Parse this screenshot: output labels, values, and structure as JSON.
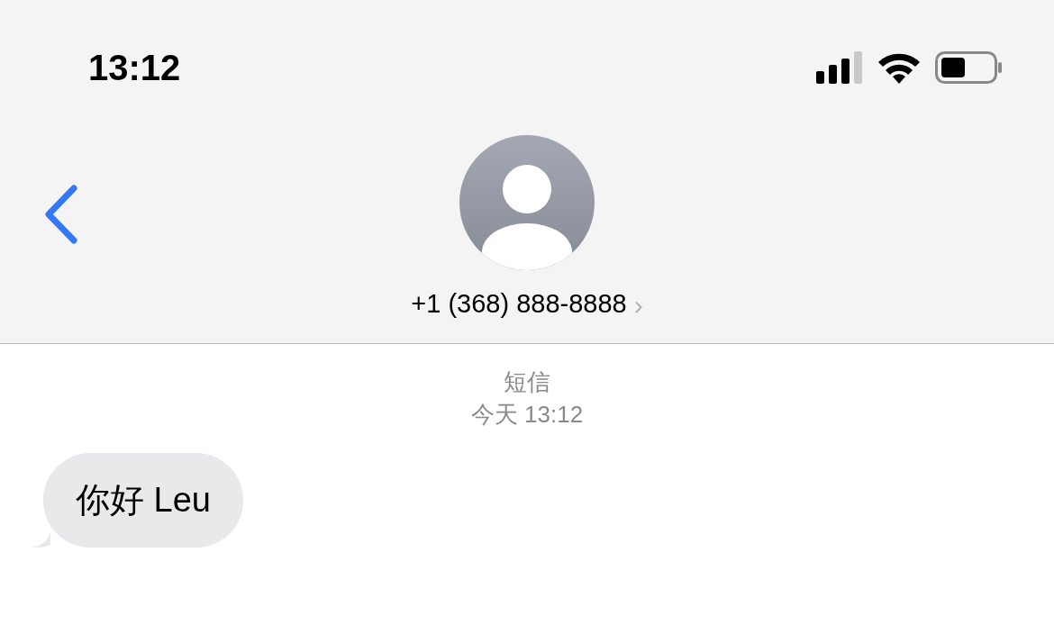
{
  "status_bar": {
    "time": "13:12"
  },
  "contact": {
    "phone": "+1 (368) 888-8888",
    "chevron": "›"
  },
  "thread_header": {
    "service": "短信",
    "timestamp": "今天 13:12"
  },
  "messages": [
    {
      "kind": "received",
      "text": "你好 Leu"
    }
  ]
}
